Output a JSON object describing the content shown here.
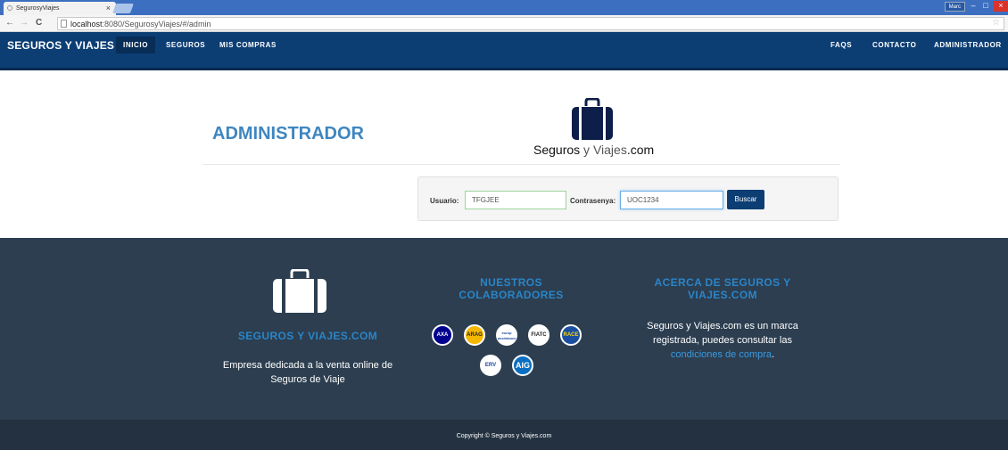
{
  "browser": {
    "tab_title": "SegurosyViajes",
    "tab_close": "×",
    "user_badge": "Marc",
    "win_min": "–",
    "win_max": "□",
    "win_close": "×",
    "back": "←",
    "forward": "→",
    "reload": "C",
    "url_host": "localhost",
    "url_rest": ":8080/SegurosyViajes/#/admin",
    "star": "☆"
  },
  "navbar": {
    "brand": "SEGUROS Y VIAJES",
    "left_items": [
      "INICIO",
      "SEGUROS",
      "MIS COMPRAS"
    ],
    "right_items": [
      "FAQS",
      "CONTACTO",
      "ADMINISTRADOR"
    ]
  },
  "main": {
    "title": "ADMINISTRADOR",
    "logo_part1": "Seguros",
    "logo_part2": "y",
    "logo_part3": "Viajes",
    "logo_part4": ".com"
  },
  "login": {
    "user_label": "Usuario:",
    "user_value": "TFGJEE",
    "pass_label": "Contrasenya:",
    "pass_value": "UOC1234",
    "button": "Buscar"
  },
  "footer": {
    "col1_heading": "SEGUROS Y VIAJES.COM",
    "col1_text_line1": "Empresa dedicada a la venta online de",
    "col1_text_line2": "Seguros de Viaje",
    "col2_heading_line1": "NUESTROS",
    "col2_heading_line2": "COLABORADORES",
    "partners": [
      "AXA",
      "ARAG",
      "europ assistance",
      "FIATC",
      "RACE",
      "ERV",
      "AIG"
    ],
    "col3_heading_line1": "ACERCA DE SEGUROS Y",
    "col3_heading_line2": "VIAJES.COM",
    "col3_text_line1": "Seguros y Viajes.com es un marca",
    "col3_text_line2": "registrada, puedes consultar las",
    "col3_link": "condiciones de compra",
    "col3_dot": ".",
    "copyright": "Copyright © Seguros y Viajes.com"
  },
  "colors": {
    "navbar": "#0c3e74",
    "accent": "#2a85c7",
    "footer": "#2c3e50"
  }
}
